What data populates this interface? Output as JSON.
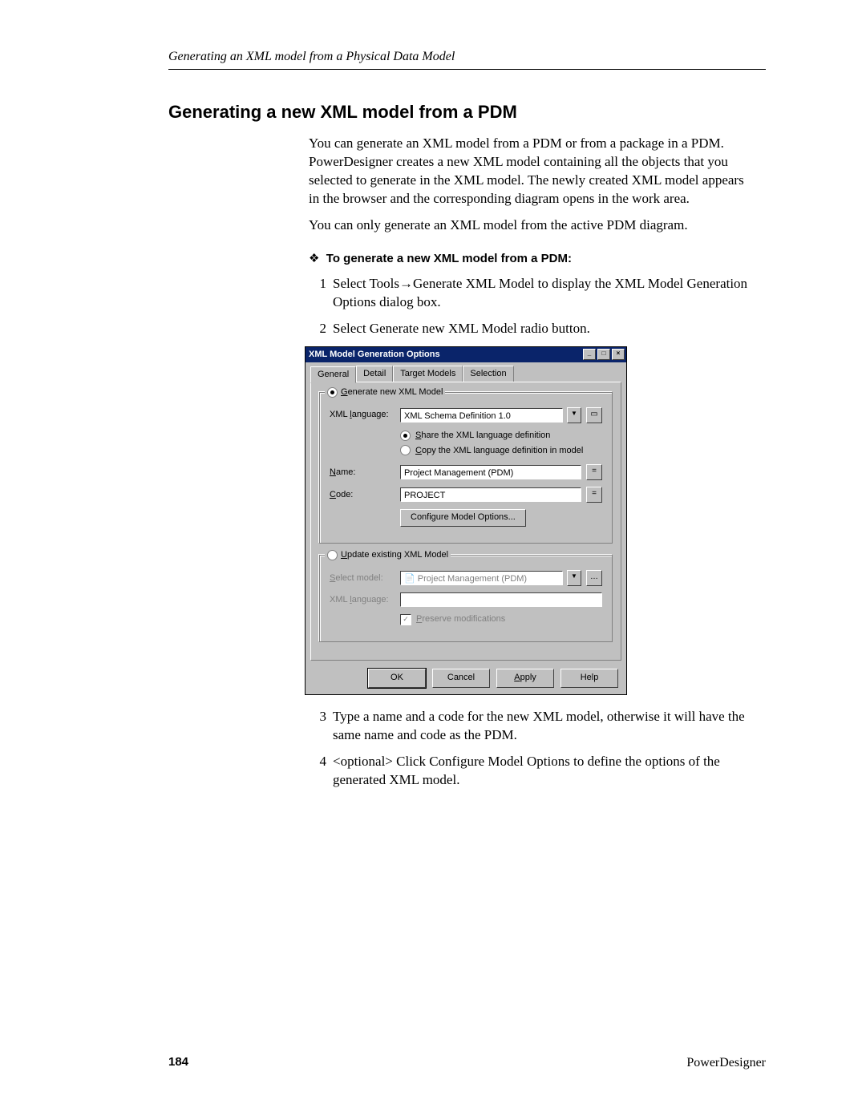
{
  "running_head": "Generating an XML model from a Physical Data Model",
  "heading": "Generating a new XML model from a PDM",
  "para1": "You can generate an XML model from a PDM or from a package in a PDM. PowerDesigner creates a new XML model containing all the objects that you selected to generate in the XML model. The newly created XML model appears in the browser and the corresponding diagram opens in the work area.",
  "para2": "You can only generate an XML model from the active PDM diagram.",
  "proc_head": "To generate a new XML model from a PDM:",
  "steps": {
    "s1_pre": "Select Tools",
    "s1_post": "Generate XML Model to display the XML Model Generation Options dialog box.",
    "s2": "Select Generate new XML Model radio button.",
    "s3": "Type a name and a code for the new XML model, otherwise it will have the same name and code as the PDM.",
    "s4": "<optional> Click Configure Model Options to define the options of the generated XML model."
  },
  "dialog": {
    "title": "XML Model Generation Options",
    "tabs": [
      "General",
      "Detail",
      "Target Models",
      "Selection"
    ],
    "active_tab": 0,
    "group_new": "Generate new XML Model",
    "group_update": "Update existing XML Model",
    "xml_language_label": "XML language:",
    "xml_language_value": "XML Schema Definition 1.0",
    "share_option": "Share the XML language definition",
    "copy_option": "Copy the XML language definition in model",
    "name_label": "Name:",
    "name_value": "Project Management (PDM)",
    "code_label": "Code:",
    "code_value": "PROJECT",
    "configure_btn": "Configure Model Options...",
    "select_model_label": "Select model:",
    "select_model_value": "Project Management (PDM)",
    "xml_language_label2": "XML language:",
    "preserve": "Preserve modifications",
    "ok": "OK",
    "cancel": "Cancel",
    "apply": "Apply",
    "help": "Help"
  },
  "footer": {
    "page_number": "184",
    "product": "PowerDesigner"
  }
}
